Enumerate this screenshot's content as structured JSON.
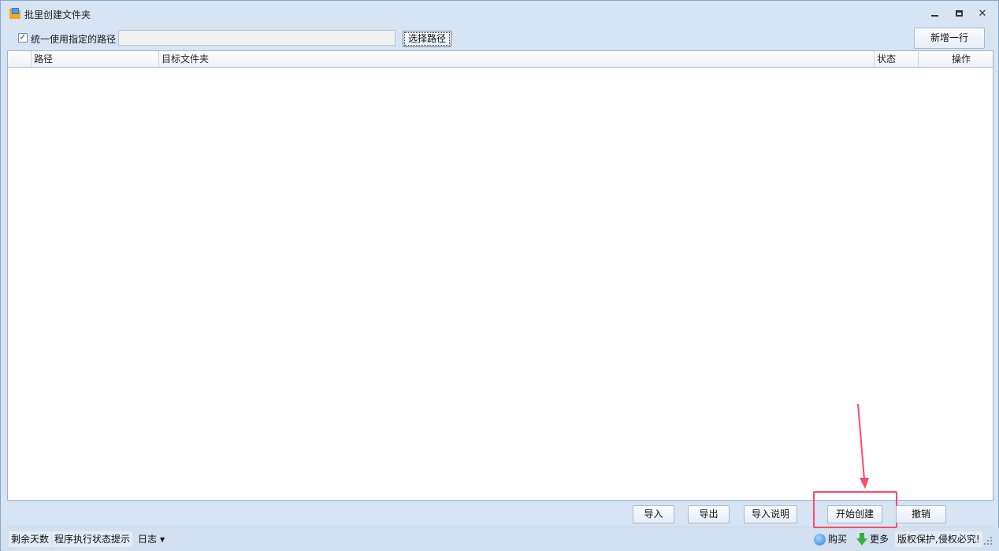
{
  "window": {
    "title": "批里创建文件夹"
  },
  "toolbar": {
    "checkbox_checked": true,
    "checkbox_label": "统一使用指定的路径",
    "path_value": "",
    "select_path_label": "选择路径",
    "new_row_label": "新增一行"
  },
  "grid": {
    "columns": [
      "",
      "路径",
      "目标文件夹",
      "状态",
      "操作"
    ],
    "rows": []
  },
  "bottom": {
    "import_label": "导入",
    "export_label": "导出",
    "import_help_label": "导入说明",
    "start_label": "开始创建",
    "cancel_label": "撤销"
  },
  "statusbar": {
    "days_label": "剩余天数",
    "status_label": "程序执行状态提示",
    "log_label": "日志",
    "buy_label": "购买",
    "more_label": "更多",
    "copyright_label": "版权保护,侵权必究!"
  },
  "colors": {
    "highlight": "#ff4a6a",
    "window_bg": "#d7e4f3"
  }
}
